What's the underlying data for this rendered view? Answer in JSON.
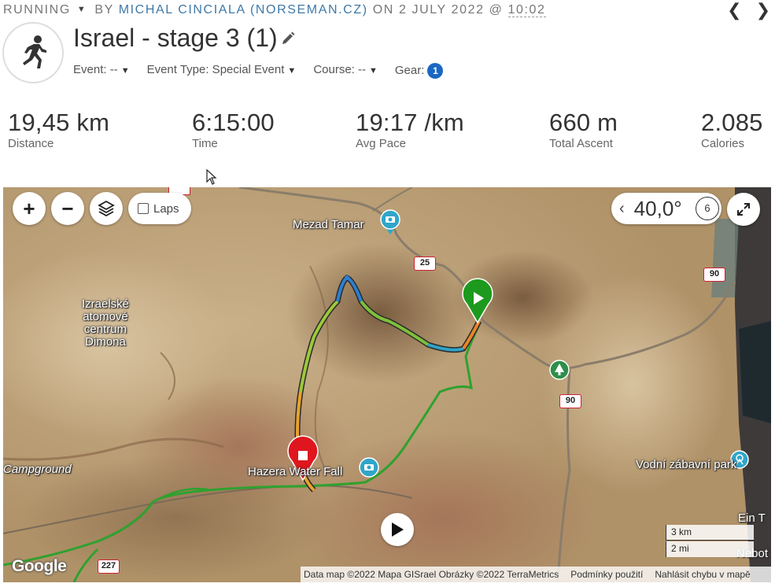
{
  "header": {
    "activity_type": "Running",
    "by_label": "by",
    "author": "Michal Cinciala (norseman.cz)",
    "on_label": "on",
    "date": "2 July 2022",
    "at_label": "@",
    "time": "10:02",
    "prev_icon": "chevron-left-icon",
    "next_icon": "chevron-right-icon"
  },
  "activity": {
    "title": "Israel - stage 3 (1)",
    "icon": "runner-icon",
    "event_label": "Event: --",
    "event_type_label": "Event Type: Special Event",
    "course_label": "Course: --",
    "gear_label": "Gear:",
    "gear_count": "1"
  },
  "stats": [
    {
      "value": "19,45 km",
      "label": "Distance"
    },
    {
      "value": "6:15:00",
      "label": "Time"
    },
    {
      "value": "19:17 /km",
      "label": "Avg Pace"
    },
    {
      "value": "660 m",
      "label": "Total Ascent"
    },
    {
      "value": "2.085",
      "label": "Calories"
    }
  ],
  "map": {
    "laps_label": "Laps",
    "angle": "40,0°",
    "rotate_value": "6",
    "labels": {
      "mezad_tamar": "Mezad Tamar",
      "dimona_1": "Izraelské",
      "dimona_2": "atomové",
      "dimona_3": "centrum",
      "dimona_4": "Dimona",
      "campground": "Campground",
      "hazera": "Hazera Water Fall",
      "park": "Vodní zábavní park",
      "ein": "Ein T",
      "nebot": "Nebot"
    },
    "roads": [
      "25",
      "90",
      "90",
      "227"
    ],
    "scale_km": "3 km",
    "scale_mi": "2 mi",
    "google": "Google",
    "attribution": {
      "data": "Data map ©2022 Mapa GISrael Obrázky ©2022 TerraMetrics",
      "terms": "Podmínky použití",
      "report": "Nahlásit chybu v mapě"
    },
    "colors": {
      "route_green": "#2fa12f",
      "start_marker": "#1d9a1d",
      "end_marker": "#e0161e"
    }
  }
}
